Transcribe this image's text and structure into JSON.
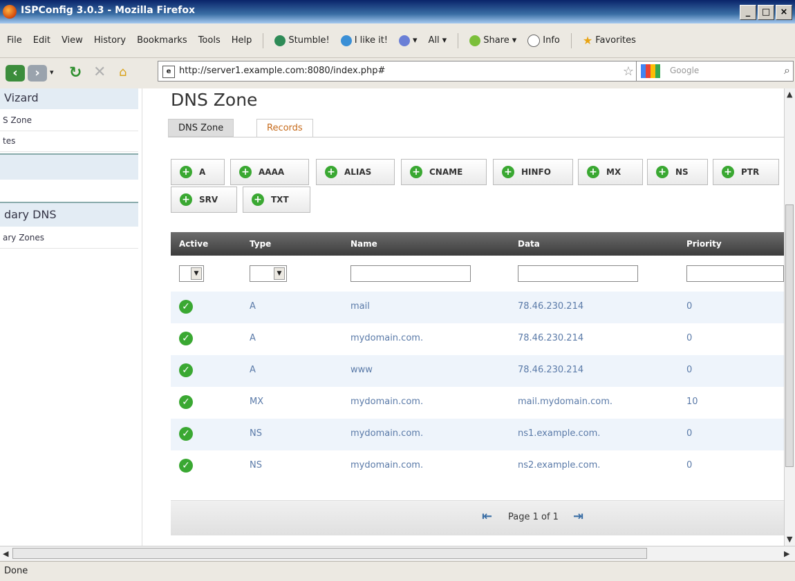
{
  "window": {
    "title": "ISPConfig 3.0.3 - Mozilla Firefox",
    "buttons": [
      "_",
      "□",
      "×"
    ]
  },
  "menubar": {
    "items": [
      "File",
      "Edit",
      "View",
      "History",
      "Bookmarks",
      "Tools",
      "Help"
    ],
    "toolbar": [
      "Stumble!",
      "I like it!",
      "All",
      "Share",
      "Info",
      "Favorites"
    ]
  },
  "nav": {
    "url": "http://server1.example.com:8080/index.php#",
    "search_placeholder": "Google"
  },
  "sidebar": {
    "section1_title": "Vizard",
    "section1_links": [
      "S Zone",
      "tes"
    ],
    "section2_title": "dary DNS",
    "section2_links": [
      "ary Zones"
    ]
  },
  "main": {
    "title": "DNS Zone",
    "tabs": [
      "DNS Zone",
      "Records"
    ],
    "record_buttons": [
      "A",
      "AAAA",
      "ALIAS",
      "CNAME",
      "HINFO",
      "MX",
      "NS",
      "PTR",
      "SRV",
      "TXT"
    ],
    "table_headers": [
      "Active",
      "Type",
      "Name",
      "Data",
      "Priority"
    ],
    "rows": [
      {
        "type": "A",
        "name": "mail",
        "data": "78.46.230.214",
        "priority": "0"
      },
      {
        "type": "A",
        "name": "mydomain.com.",
        "data": "78.46.230.214",
        "priority": "0"
      },
      {
        "type": "A",
        "name": "www",
        "data": "78.46.230.214",
        "priority": "0"
      },
      {
        "type": "MX",
        "name": "mydomain.com.",
        "data": "mail.mydomain.com.",
        "priority": "10"
      },
      {
        "type": "NS",
        "name": "mydomain.com.",
        "data": "ns1.example.com.",
        "priority": "0"
      },
      {
        "type": "NS",
        "name": "mydomain.com.",
        "data": "ns2.example.com.",
        "priority": "0"
      }
    ],
    "pager": "Page 1 of 1"
  },
  "status": "Done",
  "colors": {
    "accent_green": "#3aa832",
    "header_dark": "#4a4a4a",
    "link_blue": "#5a7aa8",
    "tab_orange": "#c66a1a"
  }
}
